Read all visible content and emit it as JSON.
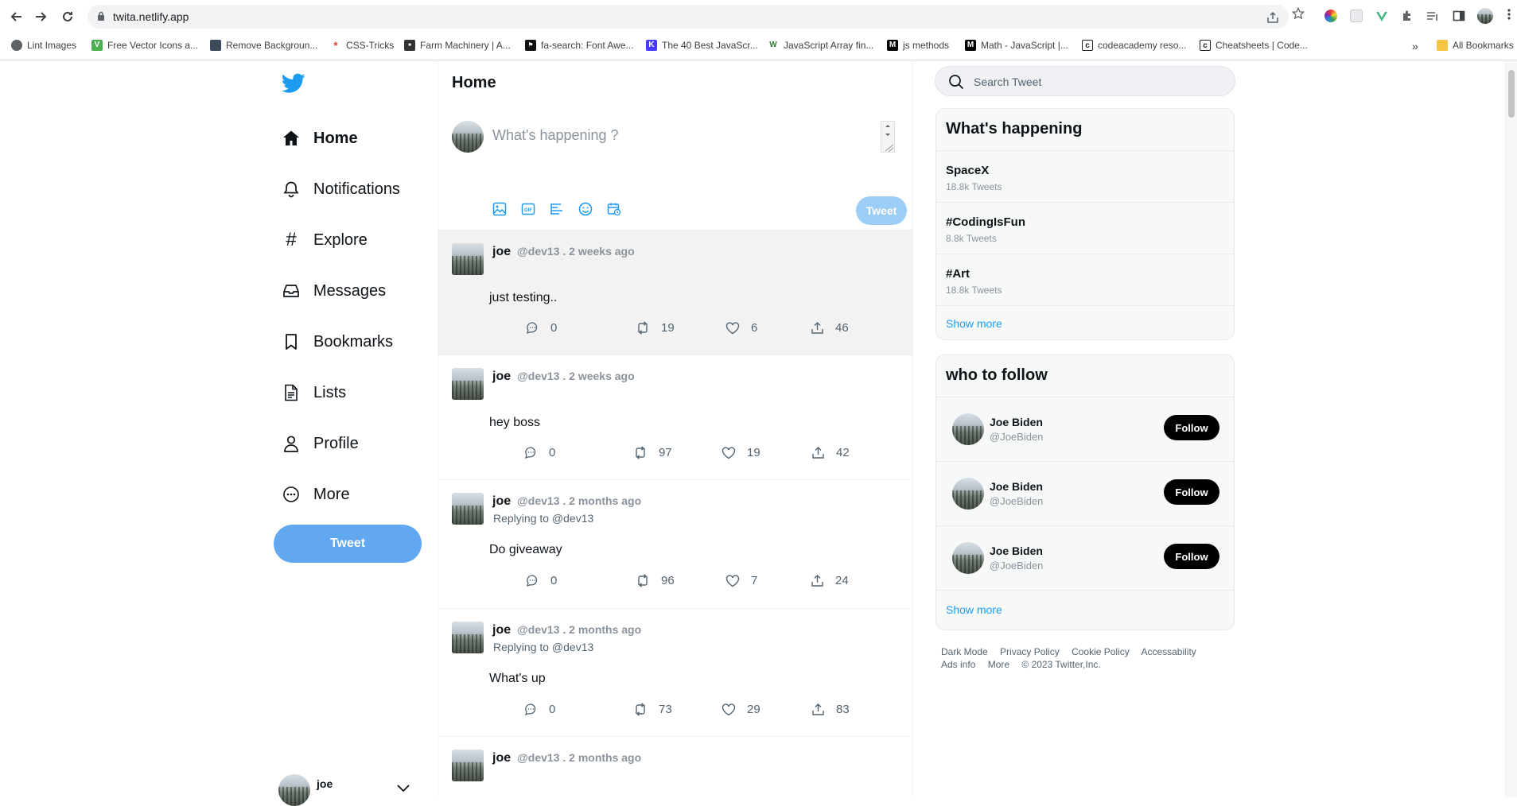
{
  "browser": {
    "url": "twita.netlify.app",
    "bookmarks": [
      {
        "label": "Lint Images",
        "icon": "globe-icon",
        "color": "#5f6368"
      },
      {
        "label": "Free Vector Icons a...",
        "icon": "vecteezy-icon",
        "color": "#4caf50"
      },
      {
        "label": "Remove Backgroun...",
        "icon": "removebg-icon",
        "color": "#3d4a5c"
      },
      {
        "label": "CSS-Tricks",
        "icon": "csstricks-icon",
        "color": "#e2492f"
      },
      {
        "label": "Farm Machinery | A...",
        "icon": "site-icon",
        "color": "#333333"
      },
      {
        "label": "fa-search: Font Awe...",
        "icon": "fontawesome-icon",
        "color": "#111111"
      },
      {
        "label": "The 40 Best JavaScr...",
        "icon": "k-icon",
        "color": "#4a3aff"
      },
      {
        "label": "JavaScript Array fin...",
        "icon": "w3-icon",
        "color": "#2e7d32"
      },
      {
        "label": "js methods",
        "icon": "m-icon",
        "color": "#000000"
      },
      {
        "label": "Math - JavaScript |...",
        "icon": "mdn-icon",
        "color": "#000000"
      },
      {
        "label": "codeacademy reso...",
        "icon": "codecademy-icon",
        "color": "#1f1f1f"
      },
      {
        "label": "Cheatsheets | Code...",
        "icon": "codecademy-icon",
        "color": "#1f1f1f"
      }
    ],
    "overflow": "»",
    "all_bookmarks": "All Bookmarks"
  },
  "sidebar": {
    "items": [
      {
        "label": "Home",
        "icon": "home-icon"
      },
      {
        "label": "Notifications",
        "icon": "bell-icon"
      },
      {
        "label": "Explore",
        "icon": "hashtag-icon"
      },
      {
        "label": "Messages",
        "icon": "inbox-icon"
      },
      {
        "label": "Bookmarks",
        "icon": "bookmark-icon"
      },
      {
        "label": "Lists",
        "icon": "list-icon"
      },
      {
        "label": "Profile",
        "icon": "user-icon"
      },
      {
        "label": "More",
        "icon": "more-icon"
      }
    ],
    "tweet_button": "Tweet",
    "user_name": "joe"
  },
  "feed": {
    "title": "Home",
    "composer_placeholder": "What's happening ?",
    "post_button": "Tweet",
    "tweets": [
      {
        "name": "joe",
        "meta": "@dev13 . 2 weeks ago",
        "reply": "",
        "text": "just testing..",
        "comments": "0",
        "retweets": "19",
        "likes": "6",
        "shares": "46"
      },
      {
        "name": "joe",
        "meta": "@dev13 . 2 weeks ago",
        "reply": "",
        "text": "hey boss",
        "comments": "0",
        "retweets": "97",
        "likes": "19",
        "shares": "42"
      },
      {
        "name": "joe",
        "meta": "@dev13 . 2 months ago",
        "reply": "Replying to @dev13",
        "text": "Do giveaway",
        "comments": "0",
        "retweets": "96",
        "likes": "7",
        "shares": "24"
      },
      {
        "name": "joe",
        "meta": "@dev13 . 2 months ago",
        "reply": "Replying to @dev13",
        "text": "What's up",
        "comments": "0",
        "retweets": "73",
        "likes": "29",
        "shares": "83"
      },
      {
        "name": "joe",
        "meta": "@dev13 . 2 months ago",
        "reply": "",
        "text": "",
        "comments": "",
        "retweets": "",
        "likes": "",
        "shares": ""
      }
    ]
  },
  "right": {
    "search_placeholder": "Search Tweet",
    "trends_title": "What's happening",
    "trends": [
      {
        "title": "SpaceX",
        "count": "18.8k Tweets"
      },
      {
        "title": "#CodingIsFun",
        "count": "8.8k Tweets"
      },
      {
        "title": "#Art",
        "count": "18.8k Tweets"
      }
    ],
    "trends_show_more": "Show more",
    "follow_title": "who to follow",
    "follow": [
      {
        "name": "Joe Biden",
        "handle": "@JoeBiden",
        "button": "Follow"
      },
      {
        "name": "Joe Biden",
        "handle": "@JoeBiden",
        "button": "Follow"
      },
      {
        "name": "Joe Biden",
        "handle": "@JoeBiden",
        "button": "Follow"
      }
    ],
    "follow_show_more": "Show more",
    "footer": [
      "Dark Mode",
      "Privacy Policy",
      "Cookie Policy",
      "Accessability",
      "Ads info",
      "More",
      "© 2023 Twitter,Inc."
    ]
  },
  "colors": {
    "accent": "#1d9bf0",
    "tweet_button": "#62a8f0",
    "post_disabled": "#9ccdf6"
  }
}
